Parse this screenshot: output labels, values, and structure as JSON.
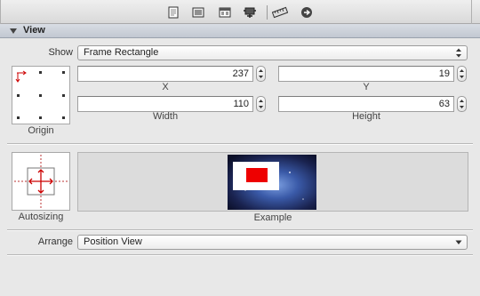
{
  "toolbar": {
    "icons": [
      "file-icon",
      "identity-icon",
      "attributes-icon",
      "connections-icon",
      "ruler-icon",
      "bindings-icon"
    ]
  },
  "section": {
    "title": "View"
  },
  "show": {
    "label": "Show",
    "value": "Frame Rectangle"
  },
  "origin": {
    "caption": "Origin"
  },
  "fields": {
    "x": {
      "value": "237",
      "caption": "X"
    },
    "y": {
      "value": "19",
      "caption": "Y"
    },
    "width": {
      "value": "110",
      "caption": "Width"
    },
    "height": {
      "value": "63",
      "caption": "Height"
    }
  },
  "autosizing": {
    "caption": "Autosizing"
  },
  "example": {
    "caption": "Example"
  },
  "arrange": {
    "label": "Arrange",
    "value": "Position View"
  }
}
